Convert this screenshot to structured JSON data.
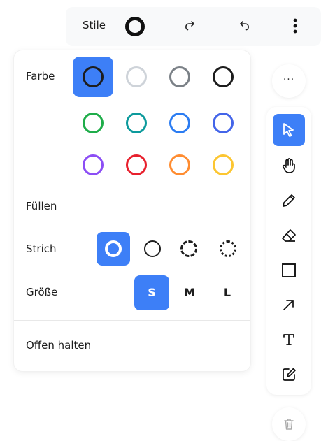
{
  "topbar": {
    "style_label": "Stile"
  },
  "panel": {
    "color_label": "Farbe",
    "fill_label": "Füllen",
    "stroke_label": "Strich",
    "size_label": "Größe",
    "keep_open_label": "Offen halten",
    "colors": [
      {
        "name": "black",
        "hex": "#1d1d1d",
        "selected": true
      },
      {
        "name": "light-grey",
        "hex": "#ced3d9"
      },
      {
        "name": "grey",
        "hex": "#7b8187"
      },
      {
        "name": "black",
        "hex": "#1d1d1d"
      },
      {
        "name": "green",
        "hex": "#1fad4a"
      },
      {
        "name": "teal",
        "hex": "#0c9a9c"
      },
      {
        "name": "blue",
        "hex": "#2b7cf2"
      },
      {
        "name": "violet",
        "hex": "#4465e9"
      },
      {
        "name": "purple",
        "hex": "#8c4ef5"
      },
      {
        "name": "red",
        "hex": "#e8202d"
      },
      {
        "name": "orange",
        "hex": "#ff8c30"
      },
      {
        "name": "yellow",
        "hex": "#fcc631"
      }
    ],
    "stroke_styles": [
      "solid-thick",
      "solid",
      "dashed",
      "dotted"
    ],
    "stroke_selected": "solid-thick",
    "sizes": [
      "S",
      "M",
      "L"
    ],
    "size_selected": "S"
  },
  "more_button": {
    "label": "···"
  },
  "toolbar": {
    "tools": [
      "select",
      "hand",
      "draw",
      "eraser",
      "rectangle",
      "arrow",
      "text",
      "note"
    ],
    "selected_tool": "select"
  },
  "accent_color": "#3d7ff7"
}
